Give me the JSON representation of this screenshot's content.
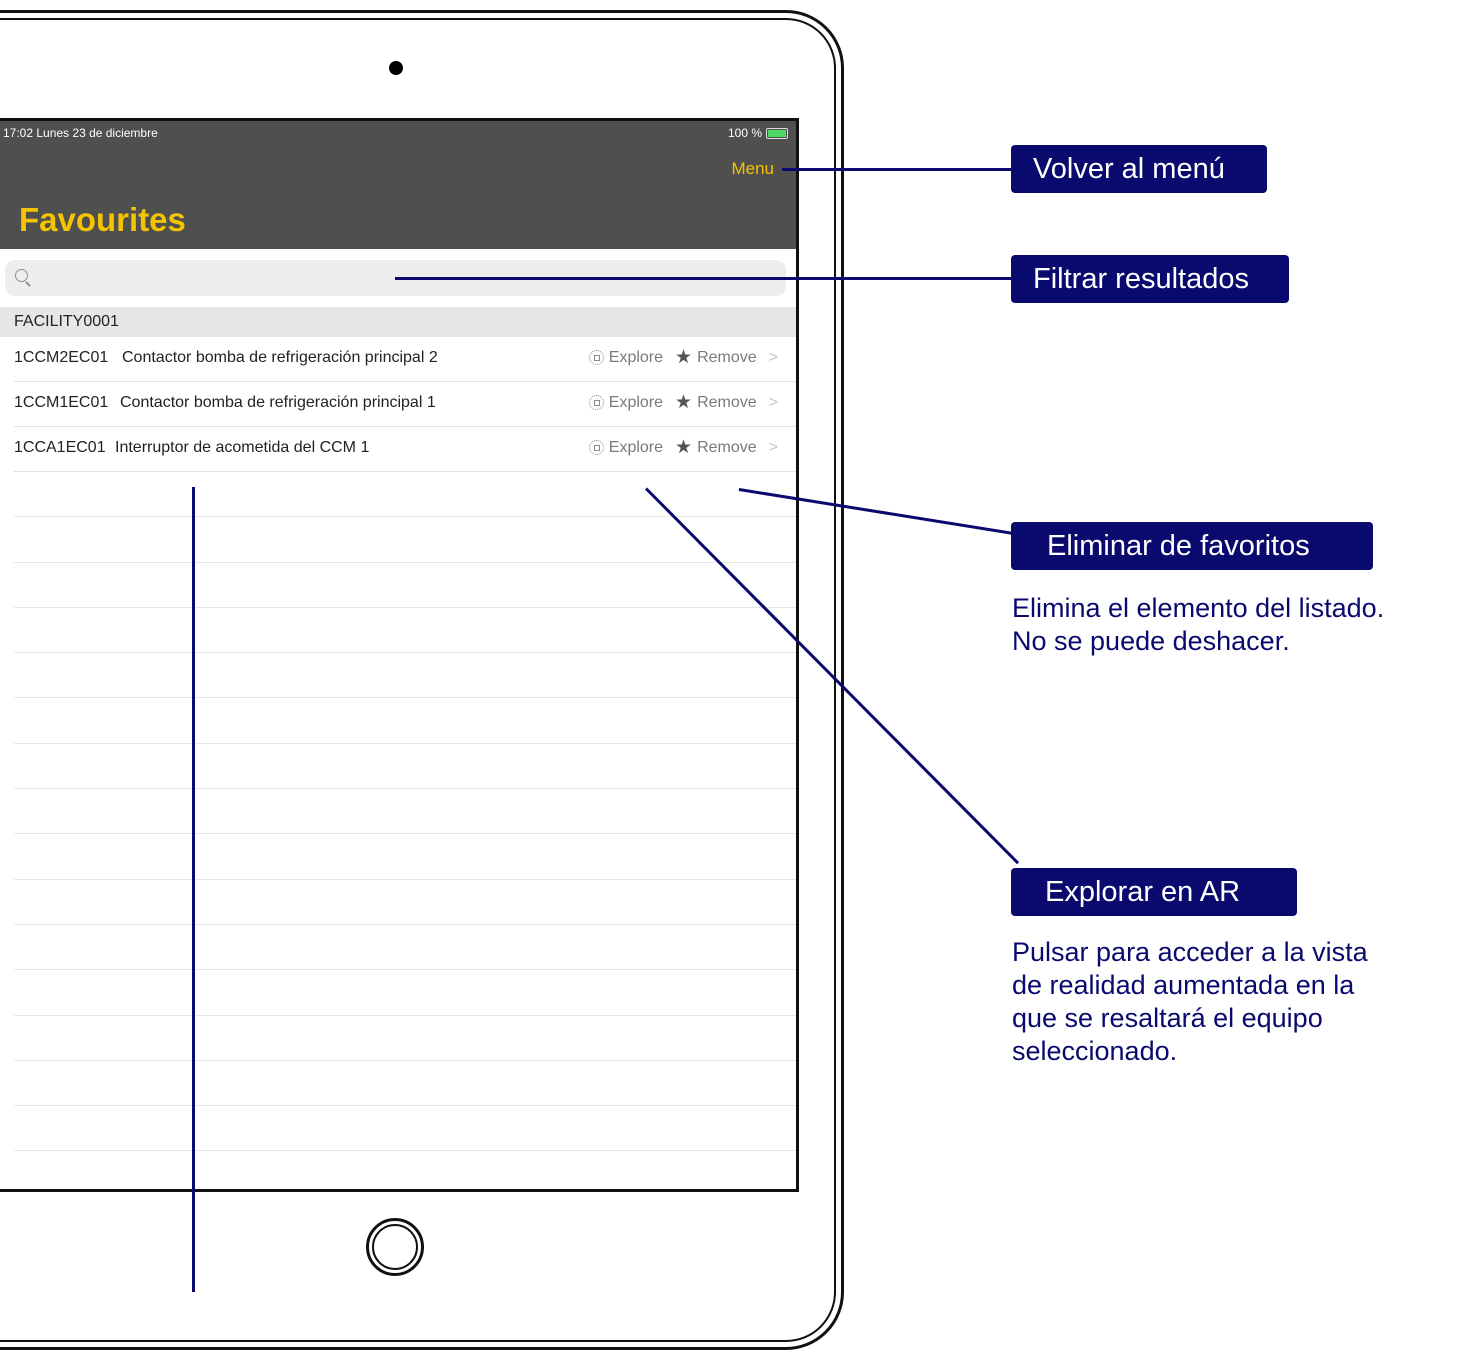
{
  "status_bar": {
    "time_date": "17:02  Lunes 23 de diciembre",
    "battery_text": "100 %"
  },
  "navbar": {
    "menu_label": "Menu",
    "title": "Favourites"
  },
  "search": {
    "placeholder": ""
  },
  "list": {
    "section_header": "FACILITY0001",
    "rows": [
      {
        "code": "1CCM2EC01",
        "description": "Contactor bomba de refrigeración principal 2",
        "explore_label": "Explore",
        "remove_label": "Remove"
      },
      {
        "code": "1CCM1EC01",
        "description": "Contactor bomba de refrigeración principal 1",
        "explore_label": "Explore",
        "remove_label": "Remove"
      },
      {
        "code": "1CCA1EC01",
        "description": "Interruptor de acometida del CCM 1",
        "explore_label": "Explore",
        "remove_label": "Remove"
      }
    ]
  },
  "callouts": {
    "back_to_menu": "Volver al menú",
    "filter_results": "Filtrar resultados",
    "remove_favourites": "Eliminar de favoritos",
    "remove_note": "Elimina el elemento del listado.\nNo se puede deshacer.",
    "explore_ar": "Explorar en AR",
    "explore_note": "Pulsar para acceder a la vista\nde realidad aumentada en la\nque se resaltará el equipo\nseleccionado."
  },
  "colors": {
    "accent": "#f5c400",
    "navbar": "#4f4f4f",
    "callout": "#0a0a6e"
  }
}
